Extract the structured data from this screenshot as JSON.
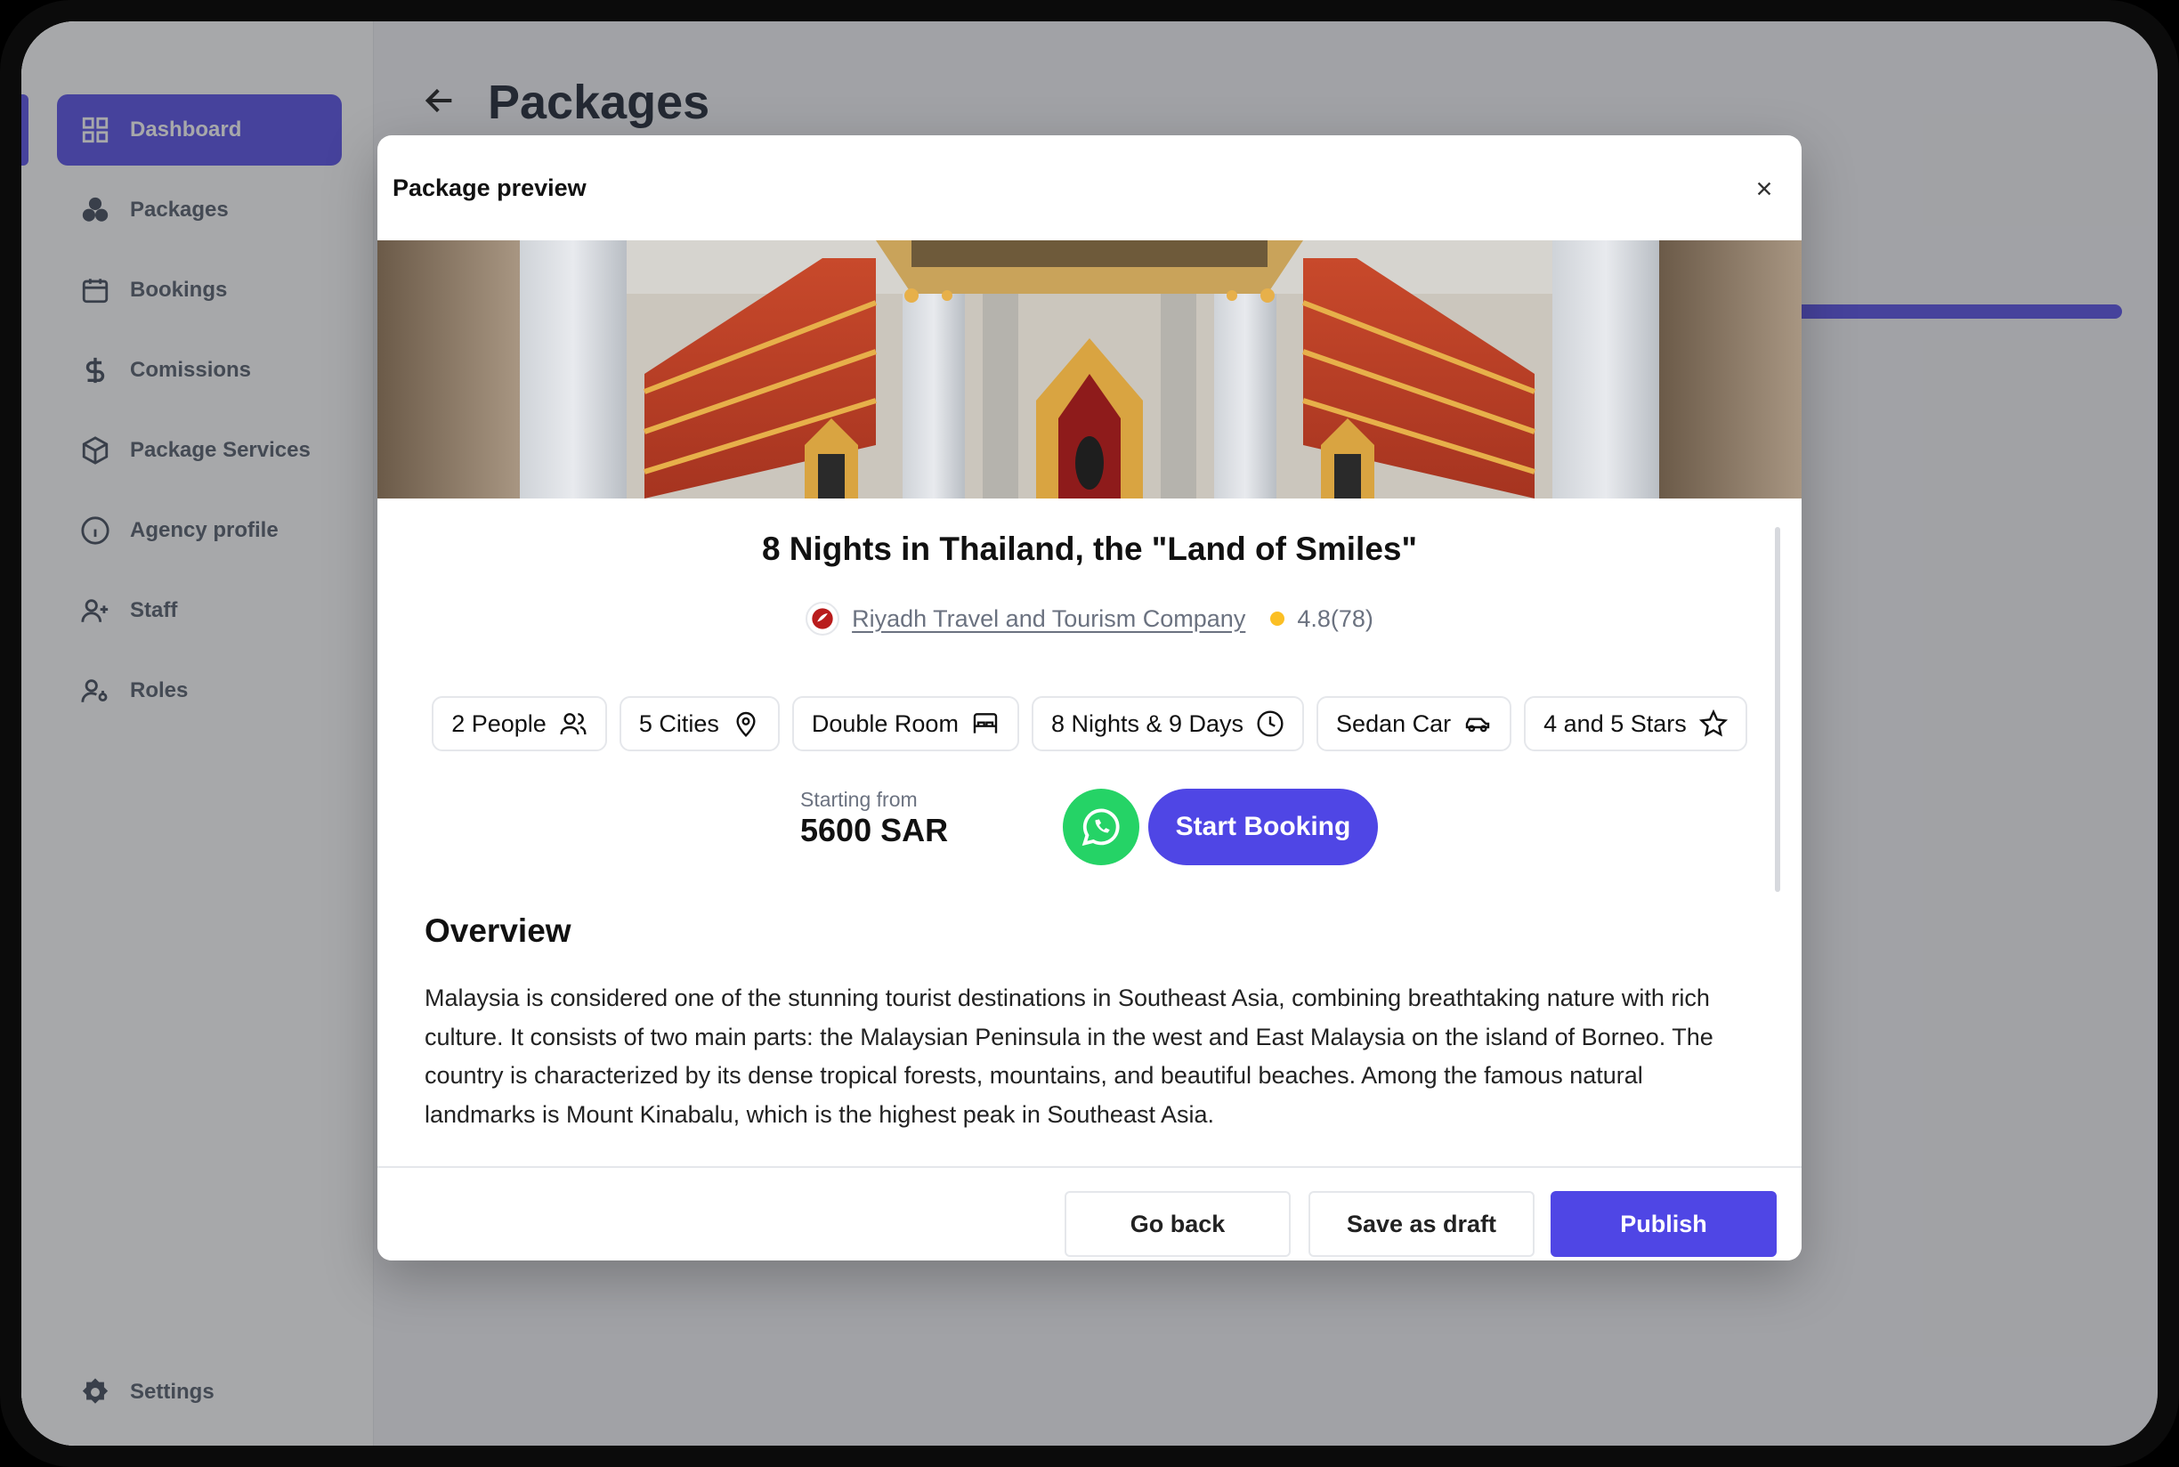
{
  "sidebar": {
    "items": [
      {
        "label": "Dashboard",
        "icon": "dashboard-icon",
        "active": true
      },
      {
        "label": "Packages",
        "icon": "packages-icon"
      },
      {
        "label": "Bookings",
        "icon": "calendar-icon"
      },
      {
        "label": "Comissions",
        "icon": "dollar-icon"
      },
      {
        "label": "Package Services",
        "icon": "box-icon"
      },
      {
        "label": "Agency profile",
        "icon": "info-icon"
      },
      {
        "label": "Staff",
        "icon": "user-plus-icon"
      },
      {
        "label": "Roles",
        "icon": "user-key-icon"
      }
    ],
    "settings_label": "Settings"
  },
  "main": {
    "page_title": "Packages",
    "progress": 1.0
  },
  "modal": {
    "title": "Package preview",
    "package_title": "8 Nights in Thailand, the \"Land of Smiles\"",
    "agency_name": "Riyadh Travel and Tourism Company",
    "rating": "4.8(78)",
    "chips": [
      {
        "label": "2 People",
        "icon": "people-icon"
      },
      {
        "label": "5 Cities",
        "icon": "location-pin-icon"
      },
      {
        "label": "Double Room",
        "icon": "bed-icon"
      },
      {
        "label": "8 Nights & 9 Days",
        "icon": "clock-icon"
      },
      {
        "label": "Sedan Car",
        "icon": "car-icon"
      },
      {
        "label": "4 and 5 Stars",
        "icon": "star-icon"
      }
    ],
    "price_label": "Starting from",
    "price_value": "5600 SAR",
    "start_booking_label": "Start Booking",
    "overview_title": "Overview",
    "overview_text": "Malaysia is considered one of the stunning tourist destinations in Southeast Asia, combining breathtaking nature with rich culture. It consists of two main parts: the Malaysian Peninsula in the west and East Malaysia on the island of Borneo. The country is characterized by its dense tropical forests, mountains, and beautiful beaches. Among the famous natural landmarks is Mount Kinabalu, which is the highest peak in Southeast Asia.",
    "footer": {
      "go_back_label": "Go back",
      "save_draft_label": "Save as draft",
      "publish_label": "Publish"
    }
  },
  "colors": {
    "brand": "#4f46e5",
    "whatsapp": "#25d366",
    "rating": "#fbbf24"
  }
}
